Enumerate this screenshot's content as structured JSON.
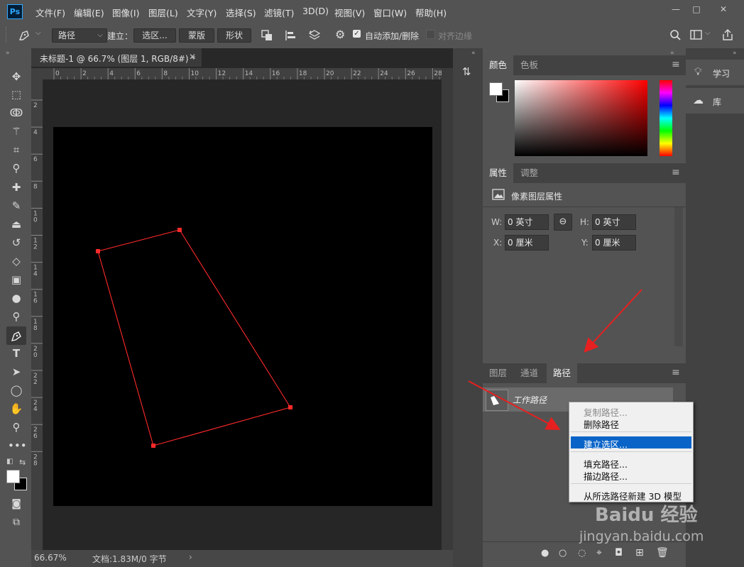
{
  "app": {
    "logo": "Ps",
    "menus": [
      "文件(F)",
      "编辑(E)",
      "图像(I)",
      "图层(L)",
      "文字(Y)",
      "选择(S)",
      "滤镜(T)",
      "3D(D)",
      "视图(V)",
      "窗口(W)",
      "帮助(H)"
    ],
    "window_controls": [
      "—",
      "□",
      "✕"
    ]
  },
  "options": {
    "mode": "路径",
    "make_label": "建立：",
    "selection_btn": "选区...",
    "mask_btn": "蒙版",
    "shape_btn": "形状",
    "auto_add_label": "自动添加/删除",
    "auto_add_checked": true,
    "align_edges_label": "对齐边缘",
    "align_edges_checked": false
  },
  "document": {
    "tab_title": "未标题-1 @ 66.7% (图层 1, RGB/8#) *",
    "ruler_top": [
      "0",
      "2",
      "4",
      "6",
      "8",
      "10",
      "12",
      "14",
      "16",
      "18",
      "20",
      "22",
      "24",
      "26",
      "28"
    ],
    "ruler_left": [
      "2",
      "4",
      "6",
      "8",
      "1 0",
      "1 2",
      "1 4",
      "1 6",
      "1 8",
      "2 0",
      "2 2",
      "2 4",
      "2 6",
      "2 8"
    ],
    "zoom": "66.67%",
    "doc_info": "文档:1.83M/0 字节"
  },
  "panels": {
    "color": {
      "tabs": [
        "颜色",
        "色板"
      ],
      "active": 0
    },
    "properties": {
      "tabs": [
        "属性",
        "调整"
      ],
      "active": 0,
      "title": "像素图层属性",
      "w_label": "W:",
      "w_value": "0 英寸",
      "h_label": "H:",
      "h_value": "0 英寸",
      "x_label": "X:",
      "x_value": "0 厘米",
      "y_label": "Y:",
      "y_value": "0 厘米"
    },
    "paths": {
      "tabs": [
        "图层",
        "通道",
        "路径"
      ],
      "active": 2,
      "items": [
        {
          "name": "工作路径"
        }
      ]
    },
    "side": {
      "learn": "学习",
      "library": "库"
    }
  },
  "context_menu": {
    "items": [
      {
        "label": "复制路径...",
        "disabled": true
      },
      {
        "label": "删除路径",
        "disabled": false
      },
      {
        "label": "建立选区...",
        "disabled": false,
        "highlighted": true
      },
      {
        "label": "填充路径...",
        "disabled": false
      },
      {
        "label": "描边路径...",
        "disabled": false
      },
      {
        "label": "从所选路径新建 3D 模型",
        "disabled": false
      }
    ]
  },
  "watermark": {
    "text": "Baidu 经验",
    "url": "jingyan.baidu.com"
  },
  "colors": {
    "path_stroke": "#ff2a2a",
    "highlight": "#0a64c8",
    "arrow": "#e62020"
  }
}
